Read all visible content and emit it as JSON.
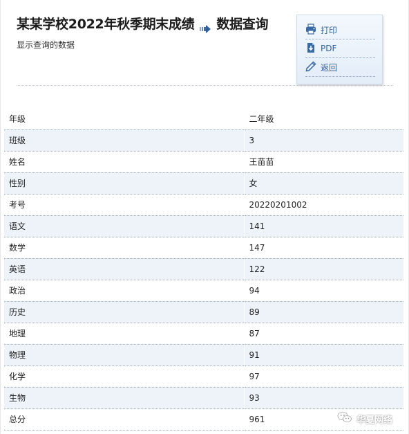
{
  "header": {
    "title": "某某学校2022年秋季期末成绩",
    "section": "数据查询",
    "subtitle": "显示查询的数据"
  },
  "toolbar": {
    "items": [
      {
        "label": "打印",
        "icon": "printer-icon"
      },
      {
        "label": "PDF",
        "icon": "download-icon"
      },
      {
        "label": "返回",
        "icon": "pencil-icon"
      }
    ]
  },
  "record": [
    {
      "key": "年级",
      "value": "二年级"
    },
    {
      "key": "班级",
      "value": "3"
    },
    {
      "key": "姓名",
      "value": "王苗苗"
    },
    {
      "key": "性别",
      "value": "女"
    },
    {
      "key": "考号",
      "value": "20220201002"
    },
    {
      "key": "语文",
      "value": "141"
    },
    {
      "key": "数学",
      "value": "147"
    },
    {
      "key": "英语",
      "value": "122"
    },
    {
      "key": "政治",
      "value": "94"
    },
    {
      "key": "历史",
      "value": "89"
    },
    {
      "key": "地理",
      "value": "87"
    },
    {
      "key": "物理",
      "value": "91"
    },
    {
      "key": "化学",
      "value": "97"
    },
    {
      "key": "生物",
      "value": "93"
    },
    {
      "key": "总分",
      "value": "961"
    }
  ],
  "watermark": {
    "text": "华夏网络",
    "icon": "wechat-icon"
  },
  "colors": {
    "accent": "#2f5f9a",
    "row_alt": "#eef3f9",
    "toolbox_bg": "#e8f0fa"
  }
}
